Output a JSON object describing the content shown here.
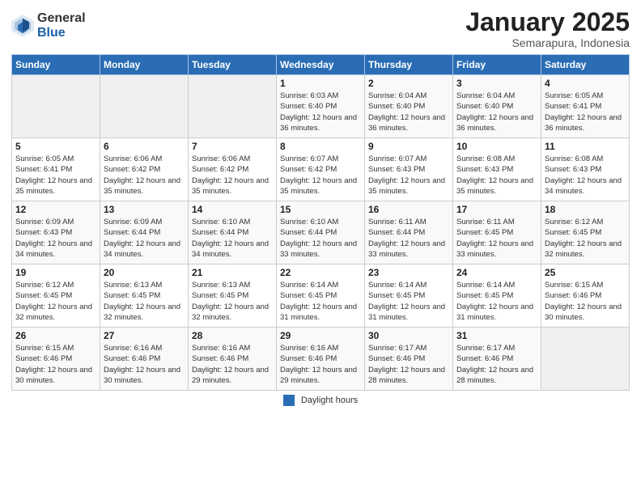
{
  "header": {
    "logo_general": "General",
    "logo_blue": "Blue",
    "month_title": "January 2025",
    "location": "Semarapura, Indonesia"
  },
  "days_of_week": [
    "Sunday",
    "Monday",
    "Tuesday",
    "Wednesday",
    "Thursday",
    "Friday",
    "Saturday"
  ],
  "weeks": [
    [
      {
        "day": "",
        "info": ""
      },
      {
        "day": "",
        "info": ""
      },
      {
        "day": "",
        "info": ""
      },
      {
        "day": "1",
        "info": "Sunrise: 6:03 AM\nSunset: 6:40 PM\nDaylight: 12 hours\nand 36 minutes."
      },
      {
        "day": "2",
        "info": "Sunrise: 6:04 AM\nSunset: 6:40 PM\nDaylight: 12 hours\nand 36 minutes."
      },
      {
        "day": "3",
        "info": "Sunrise: 6:04 AM\nSunset: 6:40 PM\nDaylight: 12 hours\nand 36 minutes."
      },
      {
        "day": "4",
        "info": "Sunrise: 6:05 AM\nSunset: 6:41 PM\nDaylight: 12 hours\nand 36 minutes."
      }
    ],
    [
      {
        "day": "5",
        "info": "Sunrise: 6:05 AM\nSunset: 6:41 PM\nDaylight: 12 hours\nand 35 minutes."
      },
      {
        "day": "6",
        "info": "Sunrise: 6:06 AM\nSunset: 6:42 PM\nDaylight: 12 hours\nand 35 minutes."
      },
      {
        "day": "7",
        "info": "Sunrise: 6:06 AM\nSunset: 6:42 PM\nDaylight: 12 hours\nand 35 minutes."
      },
      {
        "day": "8",
        "info": "Sunrise: 6:07 AM\nSunset: 6:42 PM\nDaylight: 12 hours\nand 35 minutes."
      },
      {
        "day": "9",
        "info": "Sunrise: 6:07 AM\nSunset: 6:43 PM\nDaylight: 12 hours\nand 35 minutes."
      },
      {
        "day": "10",
        "info": "Sunrise: 6:08 AM\nSunset: 6:43 PM\nDaylight: 12 hours\nand 35 minutes."
      },
      {
        "day": "11",
        "info": "Sunrise: 6:08 AM\nSunset: 6:43 PM\nDaylight: 12 hours\nand 34 minutes."
      }
    ],
    [
      {
        "day": "12",
        "info": "Sunrise: 6:09 AM\nSunset: 6:43 PM\nDaylight: 12 hours\nand 34 minutes."
      },
      {
        "day": "13",
        "info": "Sunrise: 6:09 AM\nSunset: 6:44 PM\nDaylight: 12 hours\nand 34 minutes."
      },
      {
        "day": "14",
        "info": "Sunrise: 6:10 AM\nSunset: 6:44 PM\nDaylight: 12 hours\nand 34 minutes."
      },
      {
        "day": "15",
        "info": "Sunrise: 6:10 AM\nSunset: 6:44 PM\nDaylight: 12 hours\nand 33 minutes."
      },
      {
        "day": "16",
        "info": "Sunrise: 6:11 AM\nSunset: 6:44 PM\nDaylight: 12 hours\nand 33 minutes."
      },
      {
        "day": "17",
        "info": "Sunrise: 6:11 AM\nSunset: 6:45 PM\nDaylight: 12 hours\nand 33 minutes."
      },
      {
        "day": "18",
        "info": "Sunrise: 6:12 AM\nSunset: 6:45 PM\nDaylight: 12 hours\nand 32 minutes."
      }
    ],
    [
      {
        "day": "19",
        "info": "Sunrise: 6:12 AM\nSunset: 6:45 PM\nDaylight: 12 hours\nand 32 minutes."
      },
      {
        "day": "20",
        "info": "Sunrise: 6:13 AM\nSunset: 6:45 PM\nDaylight: 12 hours\nand 32 minutes."
      },
      {
        "day": "21",
        "info": "Sunrise: 6:13 AM\nSunset: 6:45 PM\nDaylight: 12 hours\nand 32 minutes."
      },
      {
        "day": "22",
        "info": "Sunrise: 6:14 AM\nSunset: 6:45 PM\nDaylight: 12 hours\nand 31 minutes."
      },
      {
        "day": "23",
        "info": "Sunrise: 6:14 AM\nSunset: 6:45 PM\nDaylight: 12 hours\nand 31 minutes."
      },
      {
        "day": "24",
        "info": "Sunrise: 6:14 AM\nSunset: 6:45 PM\nDaylight: 12 hours\nand 31 minutes."
      },
      {
        "day": "25",
        "info": "Sunrise: 6:15 AM\nSunset: 6:46 PM\nDaylight: 12 hours\nand 30 minutes."
      }
    ],
    [
      {
        "day": "26",
        "info": "Sunrise: 6:15 AM\nSunset: 6:46 PM\nDaylight: 12 hours\nand 30 minutes."
      },
      {
        "day": "27",
        "info": "Sunrise: 6:16 AM\nSunset: 6:46 PM\nDaylight: 12 hours\nand 30 minutes."
      },
      {
        "day": "28",
        "info": "Sunrise: 6:16 AM\nSunset: 6:46 PM\nDaylight: 12 hours\nand 29 minutes."
      },
      {
        "day": "29",
        "info": "Sunrise: 6:16 AM\nSunset: 6:46 PM\nDaylight: 12 hours\nand 29 minutes."
      },
      {
        "day": "30",
        "info": "Sunrise: 6:17 AM\nSunset: 6:46 PM\nDaylight: 12 hours\nand 28 minutes."
      },
      {
        "day": "31",
        "info": "Sunrise: 6:17 AM\nSunset: 6:46 PM\nDaylight: 12 hours\nand 28 minutes."
      },
      {
        "day": "",
        "info": ""
      }
    ]
  ],
  "footer": {
    "legend_label": "Daylight hours"
  }
}
